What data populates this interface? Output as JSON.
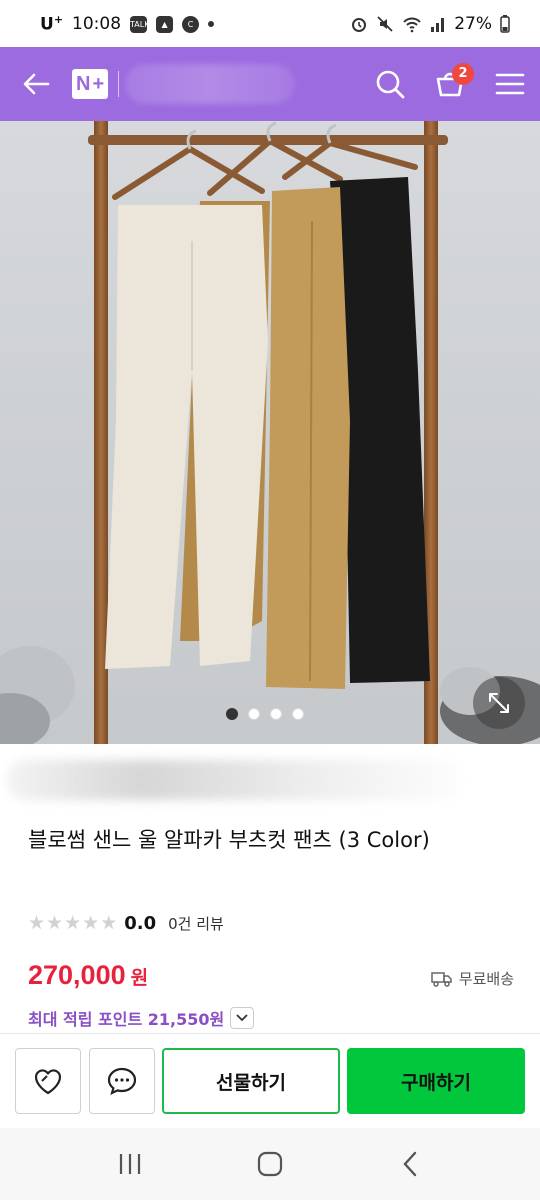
{
  "status_bar": {
    "carrier": "U",
    "carrier_sup": "+",
    "time": "10:08",
    "notification_icons": [
      "talk-icon",
      "gallery-icon",
      "c-icon"
    ],
    "battery": "27%"
  },
  "app_bar": {
    "logo_n": "N",
    "logo_plus": "+",
    "cart_count": "2",
    "accent_color": "#9c6be0"
  },
  "gallery": {
    "image_count": 4,
    "active_index": 0
  },
  "product": {
    "title": "블로썸 샌느 울 알파카 부츠컷 팬츠 (3 Color)",
    "rating_value": "0.0",
    "review_count": "0건 리뷰",
    "price": "270,000",
    "price_unit": "원",
    "shipping": "무료배송",
    "points": "최대 적립 포인트 21,550원",
    "price_color": "#e8213d",
    "points_color": "#8a4fc4"
  },
  "actions": {
    "gift_label": "선물하기",
    "buy_label": "구매하기",
    "buy_color": "#00c73c"
  }
}
